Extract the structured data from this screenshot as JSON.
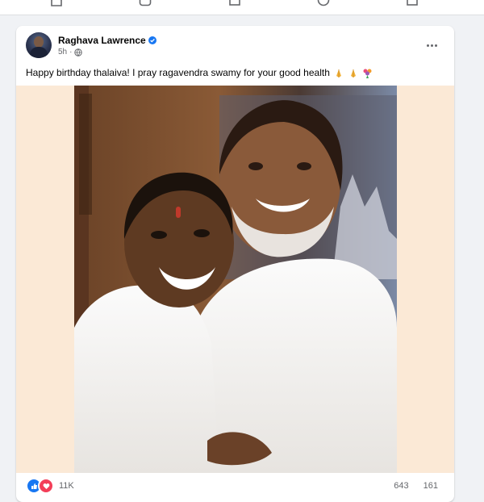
{
  "nav": {
    "icons": [
      "home-icon",
      "video-icon",
      "marketplace-icon",
      "groups-icon",
      "gaming-icon"
    ]
  },
  "post": {
    "author": "Raghava Lawrence",
    "time": "5h",
    "privacy_icon": "globe-icon",
    "verified": true,
    "text": "Happy birthday thalaiva! I pray ragavendra swamy for your good health",
    "emoji": [
      "folded-hands",
      "folded-hands",
      "flower-bouquet"
    ],
    "more_icon": "more-options-icon"
  },
  "reactions": {
    "types": [
      "like",
      "love"
    ],
    "count": "11K",
    "comments": "643",
    "shares": "161"
  },
  "colors": {
    "background": "#f0f2f5",
    "card": "#ffffff",
    "accent": "#1877f2",
    "photo_border": "#fbe9d6"
  }
}
